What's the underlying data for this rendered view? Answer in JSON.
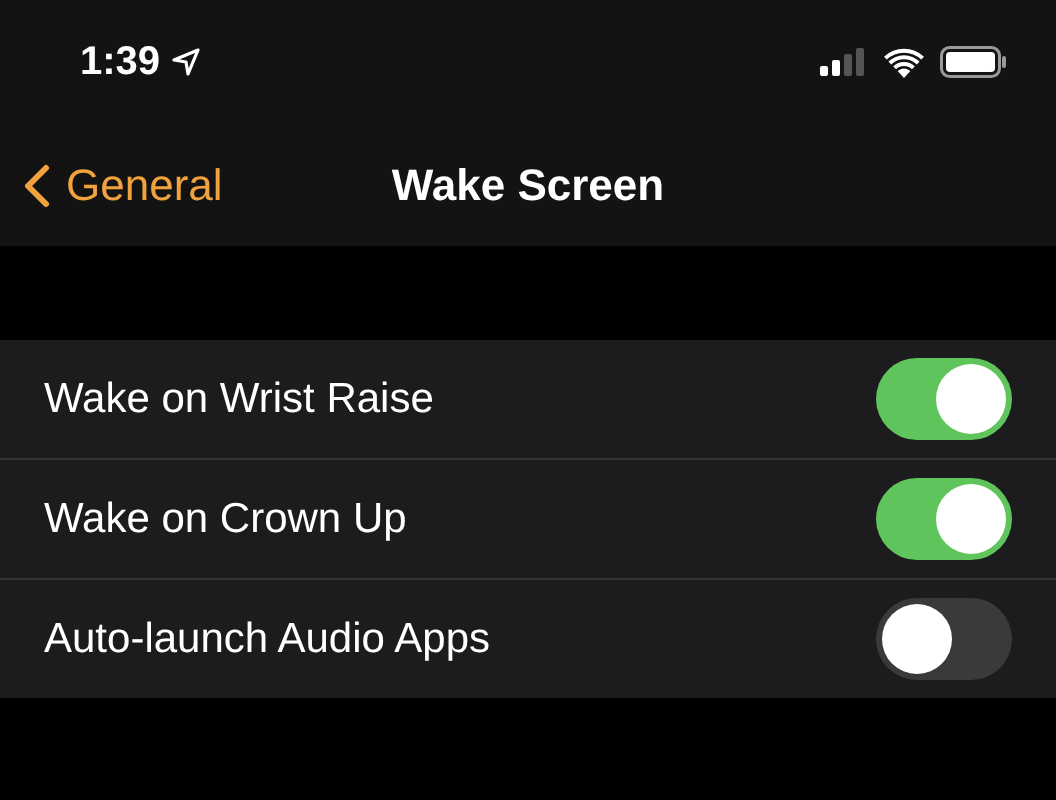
{
  "status_bar": {
    "time": "1:39"
  },
  "nav": {
    "back": "General",
    "title": "Wake Screen"
  },
  "settings": [
    {
      "label": "Wake on Wrist Raise",
      "on": true
    },
    {
      "label": "Wake on Crown Up",
      "on": true
    },
    {
      "label": "Auto-launch Audio Apps",
      "on": false
    }
  ]
}
